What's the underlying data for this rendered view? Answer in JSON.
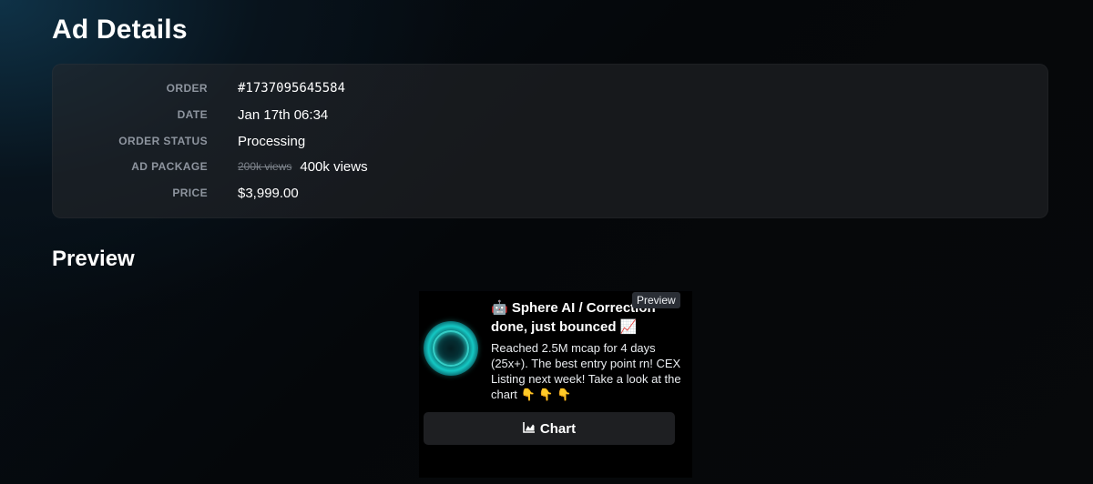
{
  "page": {
    "title": "Ad Details"
  },
  "details": {
    "order_label": "ORDER",
    "order_value": "#1737095645584",
    "date_label": "DATE",
    "date_value": "Jan 17th 06:34",
    "status_label": "ORDER STATUS",
    "status_value": "Processing",
    "package_label": "AD PACKAGE",
    "package_old": "200k views",
    "package_new": "400k views",
    "price_label": "PRICE",
    "price_value": "$3,999.00"
  },
  "preview": {
    "title": "Preview",
    "tooltip": "Preview",
    "headline_line1": "🤖 Sphere AI / Correction",
    "headline_line2": "done, just bounced 📈",
    "body": "Reached 2.5M mcap for 4 days (25x+). The best entry point rn! CEX Listing next week! Take a look at the chart 👇 👇 👇",
    "button_label": "Chart"
  },
  "icons": {
    "avatar": "teal-ring-avatar",
    "chart": "area-chart-icon"
  },
  "colors": {
    "accent_teal": "#14c8c4",
    "label_gray": "#8e959f"
  }
}
